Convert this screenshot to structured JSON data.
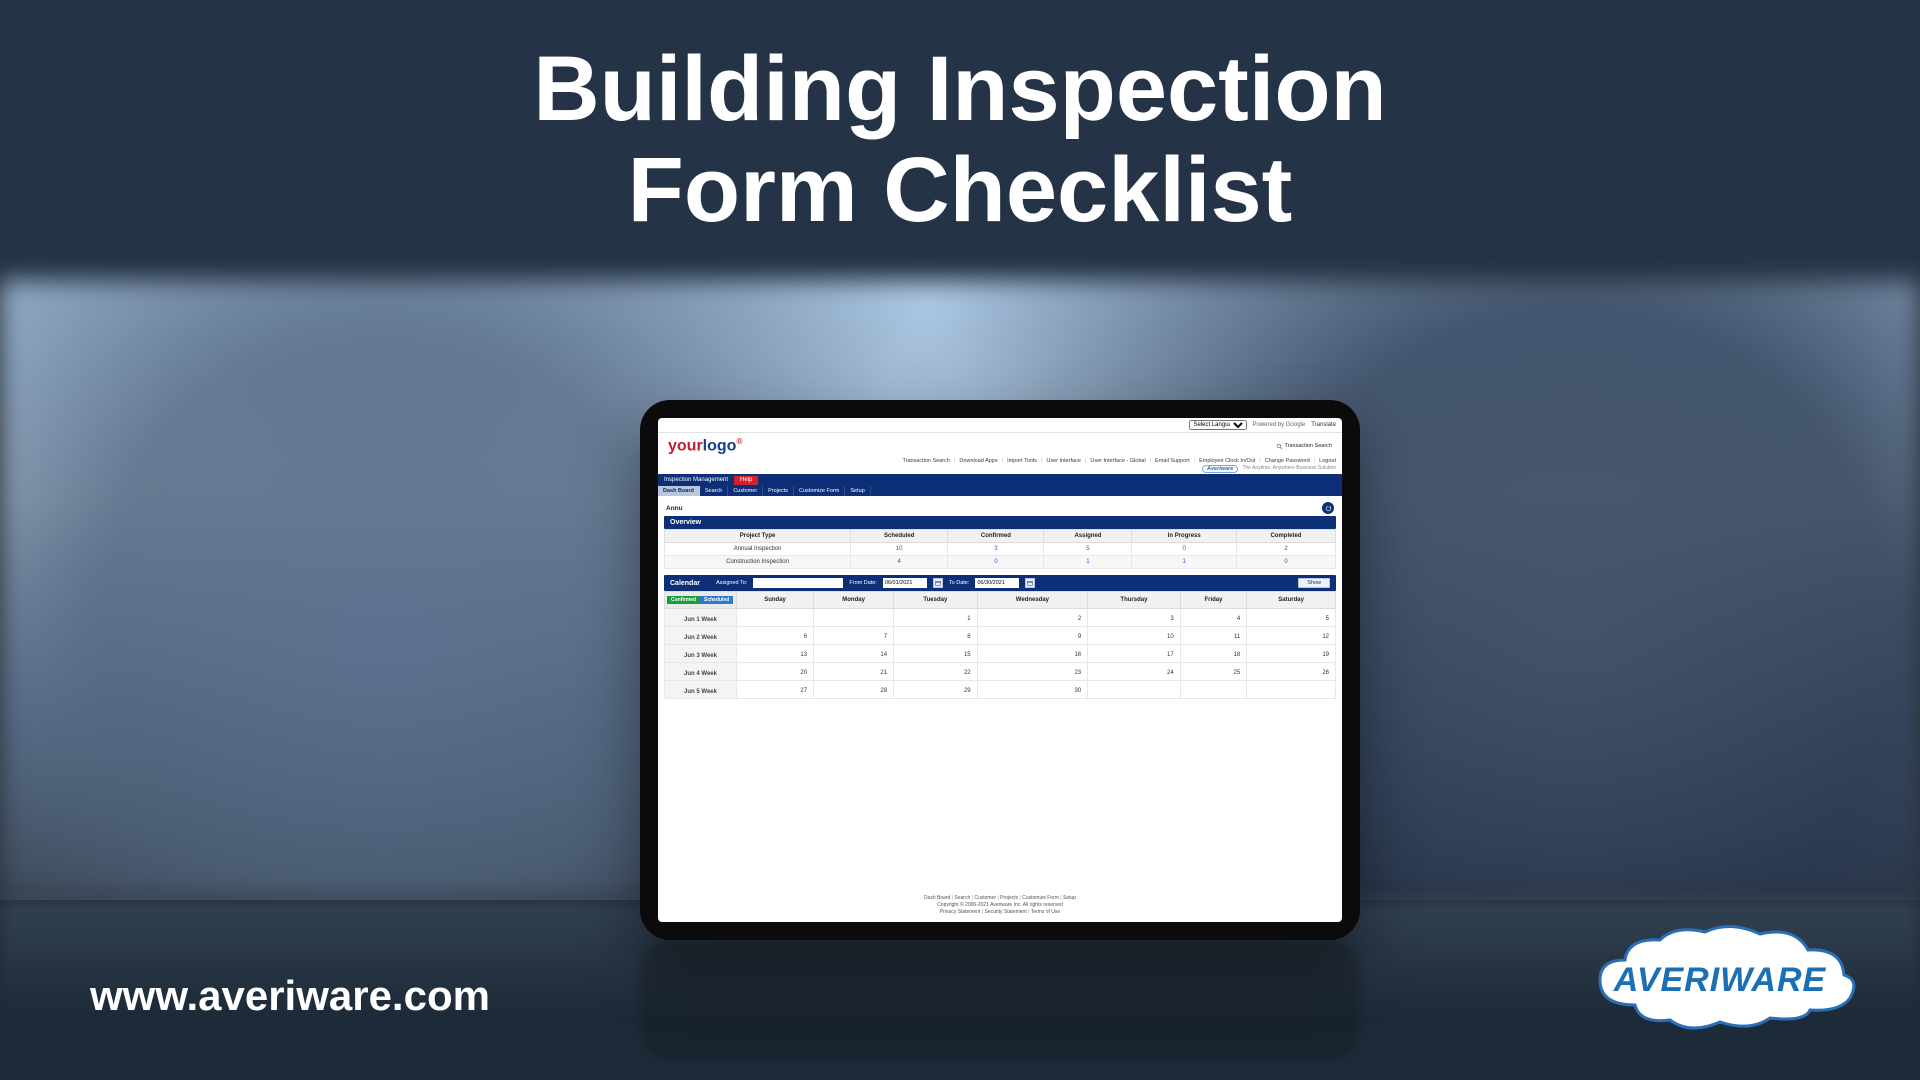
{
  "slide": {
    "title_line1": "Building Inspection",
    "title_line2": "Form Checklist",
    "url": "www.averiware.com",
    "brand": "AVERIWARE"
  },
  "top_utility": {
    "language_placeholder": "Select Language",
    "powered_by": "Powered by Google",
    "translate": "Translate"
  },
  "top_links": [
    "Transaction Search",
    "Download Apps",
    "Import Tools",
    "User Interface",
    "User Interface - Global",
    "Email Support",
    "Employee Clock In/Out",
    "Change Password",
    "Logout"
  ],
  "brand_badge": "Averiware",
  "tagline": "The Anytime, Anywhere Business Solution",
  "logo": {
    "part1": "your",
    "part2": "logo"
  },
  "quick_search": "Transaction Search",
  "nav_primary": {
    "module": "Inspection Management",
    "help": "Help"
  },
  "nav_secondary": [
    "Dash Board",
    "Search",
    "Customer",
    "Projects",
    "Customize Form",
    "Setup"
  ],
  "active_tab_index": 0,
  "user_name": "Annu",
  "overview": {
    "title": "Overview",
    "headers": [
      "Project Type",
      "Scheduled",
      "Confirmed",
      "Assigned",
      "In Progress",
      "Completed"
    ],
    "rows": [
      {
        "label": "Annual Inspection",
        "values": [
          "10",
          "3",
          "5",
          "0",
          "2"
        ]
      },
      {
        "label": "Construction Inspection",
        "values": [
          "4",
          "0",
          "1",
          "1",
          "0"
        ]
      }
    ]
  },
  "calendar": {
    "title": "Calendar",
    "assigned_label": "Assigned To:",
    "assigned_value": "",
    "from_label": "From Date:",
    "from_value": "06/01/2021",
    "to_label": "To Date:",
    "to_value": "06/30/2021",
    "show": "Show",
    "legend": {
      "confirmed": "Confirmed",
      "scheduled": "Scheduled"
    },
    "day_headers": [
      "Sunday",
      "Monday",
      "Tuesday",
      "Wednesday",
      "Thursday",
      "Friday",
      "Saturday"
    ],
    "weeks": [
      {
        "label": "Jun 1 Week",
        "days": [
          "",
          "",
          "1",
          "2",
          "3",
          "4",
          "5"
        ]
      },
      {
        "label": "Jun 2 Week",
        "days": [
          "6",
          "7",
          "8",
          "9",
          "10",
          "11",
          "12"
        ]
      },
      {
        "label": "Jun 3 Week",
        "days": [
          "13",
          "14",
          "15",
          "16",
          "17",
          "18",
          "19"
        ]
      },
      {
        "label": "Jun 4 Week",
        "days": [
          "20",
          "21",
          "22",
          "23",
          "24",
          "25",
          "26"
        ]
      },
      {
        "label": "Jun 5 Week",
        "days": [
          "27",
          "28",
          "29",
          "30",
          "",
          "",
          ""
        ]
      }
    ]
  },
  "footer": {
    "nav": [
      "Dash Board",
      "Search",
      "Customer",
      "Projects",
      "Customize Form",
      "Setup"
    ],
    "copyright": "Copyright © 2006-2021 Averiware Inc. All rights reserved",
    "legal": [
      "Privacy Statement",
      "Security Statement",
      "Terms of Use"
    ]
  }
}
